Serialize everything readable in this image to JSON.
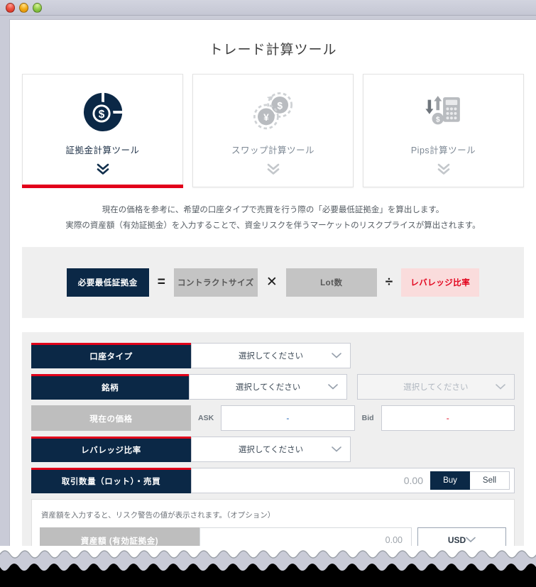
{
  "window": {
    "buttons": [
      "close-red",
      "minimize-amber",
      "maximize-green"
    ]
  },
  "header": {
    "title": "トレード計算ツール"
  },
  "tools": [
    {
      "label": "証拠金計算ツール",
      "icon": "pie-dollar-icon",
      "active": true
    },
    {
      "label": "スワップ計算ツール",
      "icon": "coins-exchange-icon",
      "active": false
    },
    {
      "label": "Pips計算ツール",
      "icon": "calculator-arrows-icon",
      "active": false
    }
  ],
  "description": {
    "line1": "現在の価格を参考に、希望の口座タイプで売買を行う際の「必要最低証拠金」を算出します。",
    "line2": "実際の資産額（有効証拠金）を入力することで、資金リスクを伴うマーケットのリスクプライスが算出されます。"
  },
  "formula": {
    "result": "必要最低証拠金",
    "equals": "=",
    "term1": "コントラクトサイズ",
    "multiply": "✕",
    "term2": "Lot数",
    "divide": "÷",
    "term3": "レバレッジ比率"
  },
  "form": {
    "account_type": {
      "label": "口座タイプ",
      "value": "選択してください"
    },
    "symbol": {
      "label": "銘柄",
      "value": "選択してください",
      "sub_value": "選択してください"
    },
    "current_price": {
      "label": "現在の価格",
      "ask_label": "ASK",
      "ask_value": "-",
      "bid_label": "Bid",
      "bid_value": "-"
    },
    "leverage": {
      "label": "レバレッジ比率",
      "value": "選択してください"
    },
    "volume": {
      "label": "取引数量（ロット）・売買",
      "value": "0.00",
      "buy_label": "Buy",
      "sell_label": "Sell",
      "selected": "Buy"
    },
    "optional": {
      "note": "資産額を入力すると、リスク警告の値が表示されます。（オプション）",
      "label": "資産額 (有効証拠金)",
      "value": "0.00",
      "currency": "USD"
    }
  },
  "colors": {
    "navy": "#0b2846",
    "red": "#e2001a",
    "gray": "#c4c4c4",
    "pink": "#fadcdc",
    "panel": "#efefef",
    "ask_blue": "#1a5fb4"
  }
}
